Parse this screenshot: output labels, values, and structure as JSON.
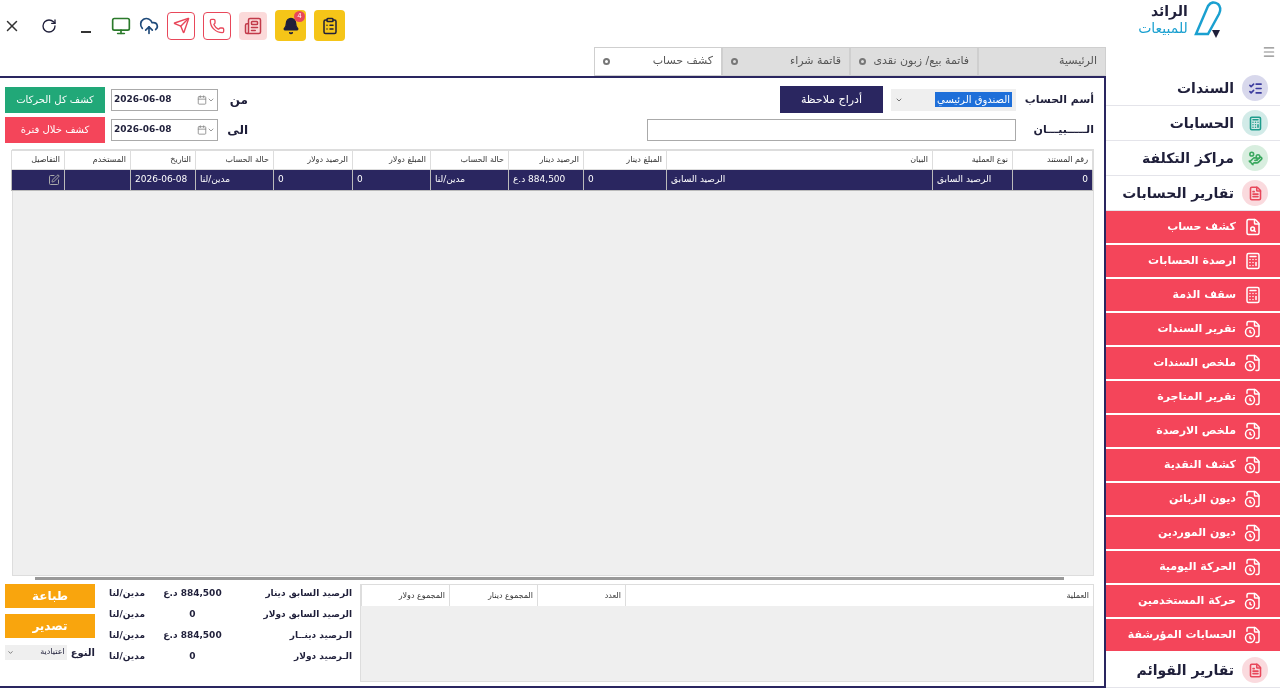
{
  "notification_badge": "4",
  "logo": {
    "line1": "الرائد",
    "line2": "للمبيعات"
  },
  "tabs": [
    {
      "label": "الرئيسية",
      "selected": false,
      "closable": false
    },
    {
      "label": "فاتمة بيع/ زبون نقدى",
      "selected": false,
      "closable": true
    },
    {
      "label": "قاتمة شراء",
      "selected": false,
      "closable": true
    },
    {
      "label": "كشف حساب",
      "selected": true,
      "closable": true
    }
  ],
  "form": {
    "account_label": "أسم الحساب",
    "account_value": "الصندوق الرئيسي",
    "add_note_button": "أدراج ملاحظة",
    "statement_label": "الـــــبيـــان",
    "from_label": "من",
    "from_date": "2026-06-08",
    "to_label": "الى",
    "to_date": "2026-06-08",
    "all_button": "كشف كل الحركات",
    "period_button": "كشف خلال فترة"
  },
  "table": {
    "columns": [
      "رقم المستند",
      "نوع العملية",
      "البيان",
      "المبلغ دينار",
      "الرصيد دينار",
      "حالة الحساب",
      "المبلغ دولار",
      "الرصيد دولار",
      "حالة الحساب",
      "التاريخ",
      "المستخدم",
      "التفاصيل"
    ],
    "rows": [
      {
        "selected": true,
        "cells": [
          "0",
          "الرصيد السابق",
          "الرصيد السابق",
          "0",
          "884,500 د.ع",
          "مدين/لنا",
          "0",
          "0",
          "مدين/لنا",
          "2026-06-08"
        ]
      }
    ]
  },
  "summary": [
    {
      "label": "الرصيد السابق دينار",
      "value": "884,500 د.ع",
      "status": "مدين/لنا"
    },
    {
      "label": "الرصيد السابق دولار",
      "value": "0",
      "status": "مدين/لنا"
    },
    {
      "label": "الـرصيد دينــار",
      "value": "884,500 د.ع",
      "status": "مدين/لنا"
    },
    {
      "label": "الـرصيد دولار",
      "value": "0",
      "status": "مدين/لنا"
    }
  ],
  "print_button": "طباعة",
  "export_button": "تصدير",
  "type_label": "النوع",
  "type_value": "اعتيادية",
  "totals_table": {
    "columns": [
      "العملية",
      "العدد",
      "المجموع دينار",
      "المجموع دولار"
    ]
  },
  "sidebar": [
    {
      "label": "السندات",
      "color": "#3b3b9e",
      "kind": "vouchers"
    },
    {
      "label": "الحسابات",
      "color": "#1e9c8c",
      "kind": "accounts"
    },
    {
      "label": "مراكز التكلفة",
      "color": "#3aa85f",
      "kind": "cost"
    },
    {
      "label": "تقارير الحسابات",
      "color": "#e8475a",
      "kind": "reports",
      "children": [
        {
          "label": "كشف حساب",
          "kind": "search"
        },
        {
          "label": "ارصدة الحسابات",
          "kind": "calculator"
        },
        {
          "label": "سقف الذمة",
          "kind": "calculator"
        },
        {
          "label": "تقرير السندات",
          "kind": "report"
        },
        {
          "label": "ملخص السندات",
          "kind": "report"
        },
        {
          "label": "تقرير المتاجرة",
          "kind": "report"
        },
        {
          "label": "ملخص الارصدة",
          "kind": "report"
        },
        {
          "label": "كشف النقدية",
          "kind": "report"
        },
        {
          "label": "ديون الزبائن",
          "kind": "report"
        },
        {
          "label": "ديون الموردين",
          "kind": "report"
        },
        {
          "label": "الحركة اليومية",
          "kind": "report"
        },
        {
          "label": "حركة المستخدمين",
          "kind": "report"
        },
        {
          "label": "الحسابات المؤرشفة",
          "kind": "report"
        }
      ]
    },
    {
      "label": "تقارير القوائم",
      "color": "#e8475a",
      "kind": "reports"
    }
  ]
}
